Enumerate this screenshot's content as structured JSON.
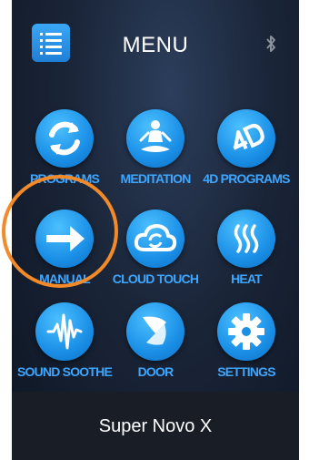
{
  "header": {
    "title": "MENU",
    "menu_icon": "list-menu-icon",
    "status_icon": "bluetooth-icon"
  },
  "tiles": [
    {
      "label": "PROGRAMS",
      "icon": "refresh-icon"
    },
    {
      "label": "MEDITATION",
      "icon": "meditation-icon"
    },
    {
      "label": "4D PROGRAMS",
      "icon": "4d-icon"
    },
    {
      "label": "MANUAL",
      "icon": "arrow-right-icon"
    },
    {
      "label": "CLOUD TOUCH",
      "icon": "cloud-sync-icon"
    },
    {
      "label": "HEAT",
      "icon": "heat-waves-icon"
    },
    {
      "label": "SOUND SOOTHE",
      "icon": "sound-wave-icon"
    },
    {
      "label": "DOOR",
      "icon": "door-icon"
    },
    {
      "label": "SETTINGS",
      "icon": "gear-icon"
    }
  ],
  "footer": {
    "model_name": "Super Novo X"
  },
  "colors": {
    "accent": "#1a8fe6",
    "label": "#3ea6ff",
    "highlight": "#f28a2a",
    "footer_bg": "#181d26"
  }
}
